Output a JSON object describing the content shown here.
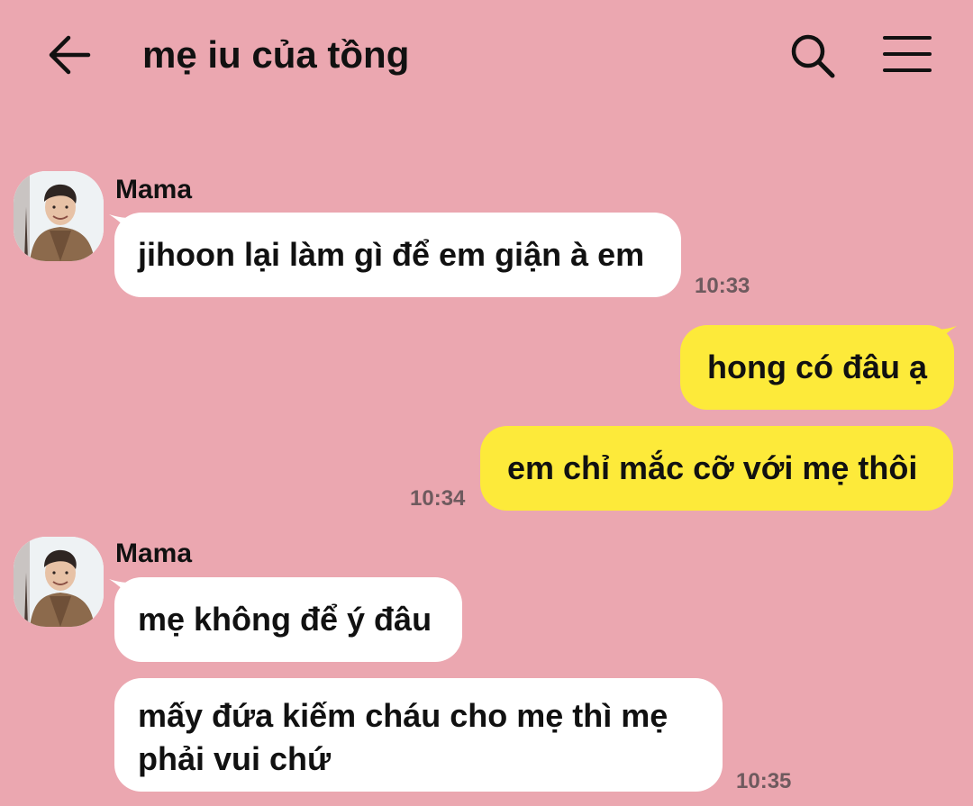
{
  "header": {
    "title": "mẹ iu của tồng",
    "icons": {
      "back": "arrow-left-icon",
      "search": "search-icon",
      "menu": "hamburger-menu-icon"
    }
  },
  "colors": {
    "background": "#eba7b0",
    "incoming_bubble": "#ffffff",
    "outgoing_bubble": "#fdea3a",
    "timestamp": "#6e5a5e",
    "text": "#111111"
  },
  "messages": [
    {
      "group": 1,
      "sender": "Mama",
      "direction": "incoming",
      "text": "jihoon lại làm gì để em giận à em",
      "time": "10:33"
    },
    {
      "group": 2,
      "direction": "outgoing",
      "text": "hong có đâu ạ"
    },
    {
      "group": 2,
      "direction": "outgoing",
      "text": "em chỉ mắc cỡ với mẹ thôi",
      "time": "10:34"
    },
    {
      "group": 3,
      "sender": "Mama",
      "direction": "incoming",
      "text": "mẹ không để ý đâu"
    },
    {
      "group": 3,
      "direction": "incoming",
      "text": "mấy đứa kiếm cháu cho mẹ thì mẹ phải vui chứ",
      "time": "10:35"
    }
  ]
}
